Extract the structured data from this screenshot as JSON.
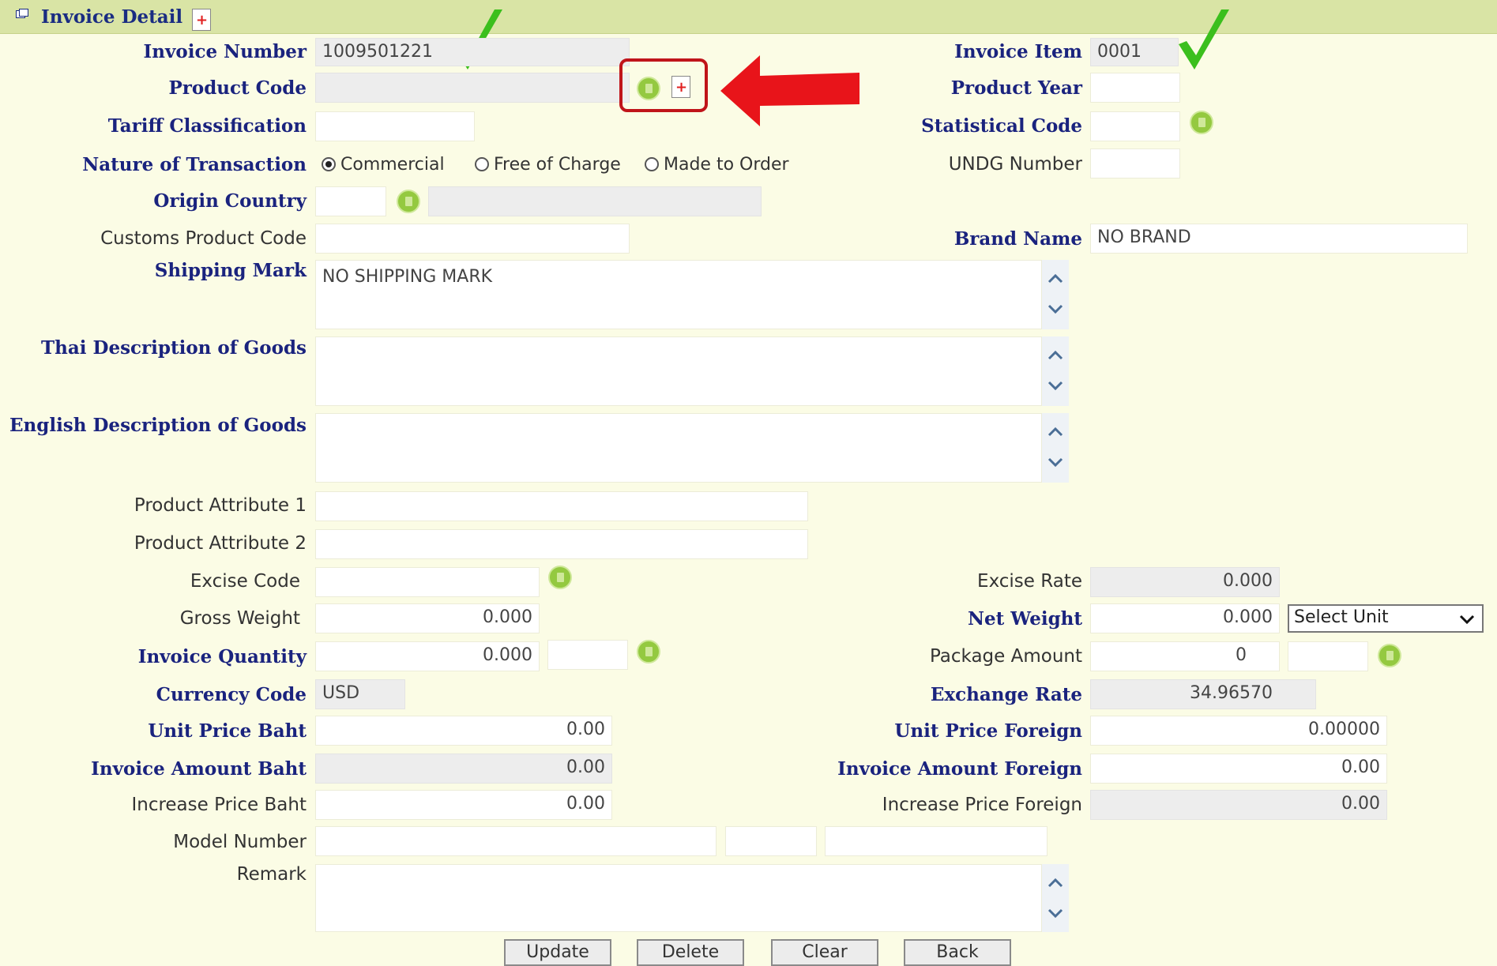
{
  "header": {
    "title": "Invoice Detail"
  },
  "labels": {
    "invoice_number": "Invoice Number",
    "product_code": "Product Code",
    "tariff_classification": "Tariff Classification",
    "nature_of_transaction": "Nature of Transaction",
    "origin_country": "Origin Country",
    "customs_product_code": "Customs Product Code",
    "shipping_mark": "Shipping Mark",
    "thai_description": "Thai Description of Goods",
    "english_description": "English Description of Goods",
    "product_attribute_1": "Product Attribute 1",
    "product_attribute_2": "Product Attribute 2",
    "excise_code": "Excise Code",
    "gross_weight": "Gross Weight",
    "invoice_quantity": "Invoice Quantity",
    "currency_code": "Currency Code",
    "unit_price_baht": "Unit Price Baht",
    "invoice_amount_baht": "Invoice Amount Baht",
    "increase_price_baht": "Increase Price Baht",
    "model_number": "Model Number",
    "remark": "Remark",
    "invoice_item": "Invoice Item",
    "product_year": "Product Year",
    "statistical_code": "Statistical Code",
    "undg_number": "UNDG Number",
    "brand_name": "Brand Name",
    "excise_rate": "Excise Rate",
    "net_weight": "Net Weight",
    "package_amount": "Package Amount",
    "exchange_rate": "Exchange Rate",
    "unit_price_foreign": "Unit Price Foreign",
    "invoice_amount_foreign": "Invoice Amount Foreign",
    "increase_price_foreign": "Increase Price Foreign"
  },
  "values": {
    "invoice_number": "1009501221",
    "invoice_item": "0001",
    "brand_name": "NO BRAND",
    "shipping_mark": "NO SHIPPING MARK",
    "excise_rate": "0.000",
    "gross_weight": "0.000",
    "net_weight": "0.000",
    "invoice_quantity": "0.000",
    "package_amount": "0",
    "currency_code": "USD",
    "exchange_rate": "34.96570",
    "unit_price_baht": "0.00",
    "unit_price_foreign": "0.00000",
    "invoice_amount_baht": "0.00",
    "invoice_amount_foreign": "0.00",
    "increase_price_baht": "0.00",
    "increase_price_foreign": "0.00"
  },
  "nature_options": [
    "Commercial",
    "Free of Charge",
    "Made to Order"
  ],
  "net_weight_unit": {
    "selected": "Select Unit"
  },
  "buttons": {
    "update": "Update",
    "delete": "Delete",
    "clear": "Clear",
    "back": "Back"
  },
  "colors": {
    "annotation_red": "#e8141a",
    "check_green": "#3bbf1d",
    "lookup_green": "#94c940"
  },
  "icons": [
    "window-icon",
    "add-document-icon",
    "lookup-icon",
    "scroll-up-icon",
    "scroll-down-icon",
    "checkmark-icon",
    "red-arrow-icon"
  ]
}
